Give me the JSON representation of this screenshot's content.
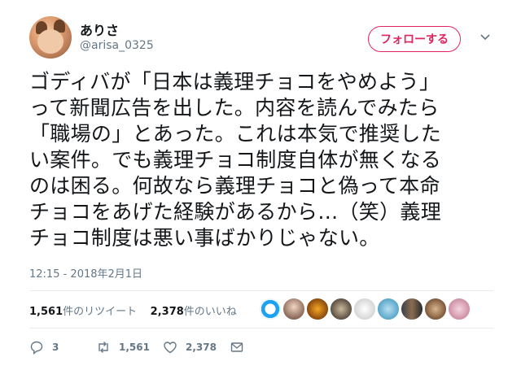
{
  "user": {
    "display_name": "ありさ",
    "handle": "@arisa_0325"
  },
  "follow_button": {
    "label": "フォローする"
  },
  "tweet": {
    "lines": [
      "ゴディバが「日本は義理チョコをやめよう」",
      "って新聞広告を出した。内容を読んでみたら",
      "「職場の」とあった。これは本気で推奨した",
      "い案件。でも義理チョコ制度自体が無くなる",
      "のは困る。何故なら義理チョコと偽って本命",
      "チョコをあげた経験があるから…（笑）義理",
      "チョコ制度は悪い事ばかりじゃない。"
    ],
    "timestamp": "12:15 - 2018年2月1日"
  },
  "stats": {
    "retweets": "1,561",
    "retweets_label": "件のリツイート",
    "likes": "2,378",
    "likes_label": "件のいいね"
  },
  "actions": {
    "reply_count": "3",
    "retweet_count": "1,561",
    "like_count": "2,378"
  },
  "colors": {
    "follow_accent": "#e0245e",
    "muted": "#657786"
  },
  "icons": [
    "chevron-down-icon",
    "reply-icon",
    "retweet-icon",
    "heart-icon",
    "message-icon"
  ]
}
